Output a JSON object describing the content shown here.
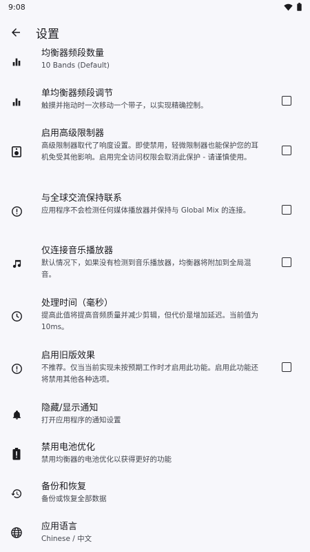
{
  "status_bar": {
    "time": "9:08",
    "icons": [
      "wifi-icon",
      "battery-icon"
    ]
  },
  "app_bar": {
    "back_icon": "arrow-back-icon",
    "title": "设置"
  },
  "colors": {
    "background": "#f7f7fb",
    "text_primary": "#1b1b1f",
    "text_secondary": "#44474f"
  },
  "settings": [
    {
      "icon": "equalizer-bars-icon",
      "title": "均衡器频段数量",
      "summary": "10 Bands (Default)",
      "checkbox": false
    },
    {
      "icon": "equalizer-bars-icon",
      "title": "单均衡器频段调节",
      "summary": "触摸并拖动时一次移动一个带子，以实现精确控制。",
      "checkbox": true,
      "checked": false
    },
    {
      "icon": "speaker-icon",
      "title": "启用高级限制器",
      "summary": "高级限制器取代了响度设置。即使禁用，轻微限制器也能保护您的耳机免受其他影响。启用完全访问权限会取消此保护 - 请谨慎使用。",
      "checkbox": true,
      "checked": false
    },
    {
      "icon": "alert-circle-icon",
      "title": "与全球交流保持联系",
      "summary": "应用程序不会检测任何媒体播放器并保持与 Global Mix 的连接。",
      "checkbox": true,
      "checked": false
    },
    {
      "icon": "music-note-icon",
      "title": "仅连接音乐播放器",
      "summary": "默认情况下，如果没有检测到音乐播放器，均衡器将附加到全局混音。",
      "checkbox": true,
      "checked": false
    },
    {
      "icon": "clock-icon",
      "title": "处理时间（毫秒）",
      "summary": "提高此值将提高音频质量并减少剪辑，但代价是增加延迟。当前值为 10ms。",
      "checkbox": false
    },
    {
      "icon": "alert-circle-icon",
      "title": "启用旧版效果",
      "summary": "不推荐。仅当当前实现未按预期工作时才启用此功能。启用此功能还将禁用其他各种选项。",
      "checkbox": true,
      "checked": false
    },
    {
      "icon": "bell-icon",
      "title": "隐藏/显示通知",
      "summary": "打开应用程序的通知设置",
      "checkbox": false
    },
    {
      "icon": "battery-alert-icon",
      "title": "禁用电池优化",
      "summary": "禁用均衡器的电池优化以获得更好的功能",
      "checkbox": false
    },
    {
      "icon": "restore-icon",
      "title": "备份和恢复",
      "summary": "备份或恢复全部数据",
      "checkbox": false
    },
    {
      "icon": "globe-icon",
      "title": "应用语言",
      "summary": "Chinese / 中文",
      "checkbox": false
    }
  ]
}
